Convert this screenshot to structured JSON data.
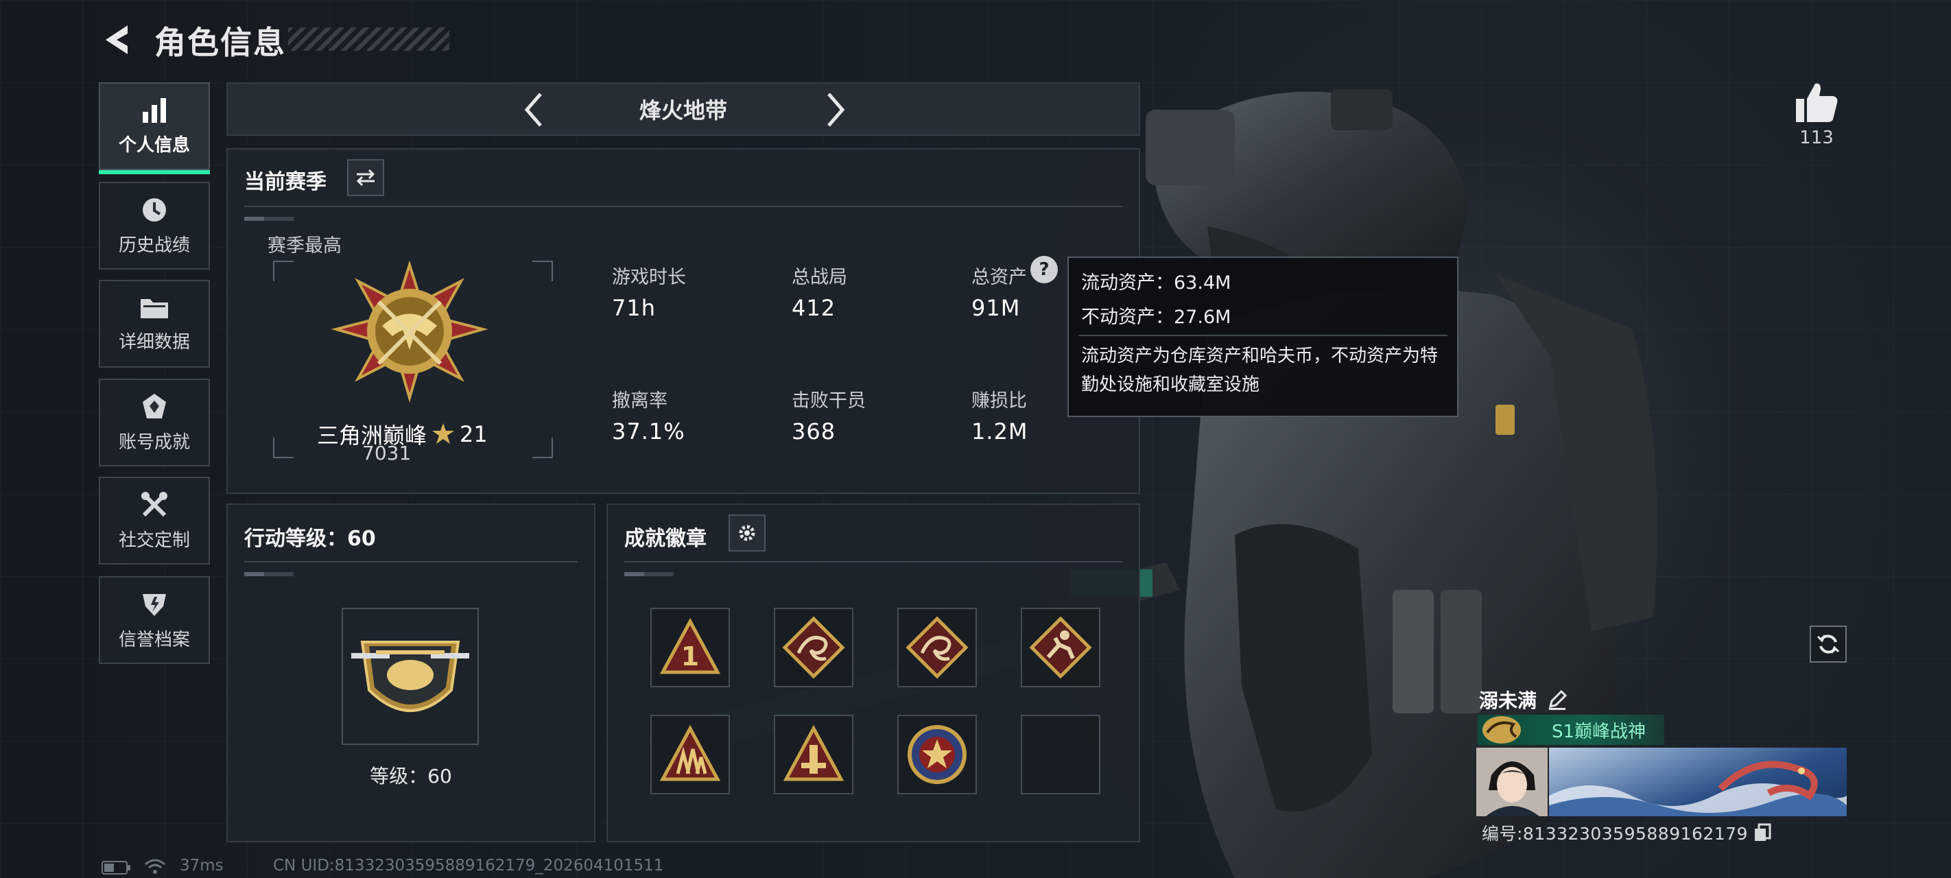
{
  "header": {
    "title": "角色信息"
  },
  "sidebar": {
    "items": [
      {
        "label": "个人信息",
        "active": true,
        "icon": "bar-chart-icon"
      },
      {
        "label": "历史战绩",
        "active": false,
        "icon": "clock-icon"
      },
      {
        "label": "详细数据",
        "active": false,
        "icon": "folder-icon"
      },
      {
        "label": "账号成就",
        "active": false,
        "icon": "achievement-icon"
      },
      {
        "label": "社交定制",
        "active": false,
        "icon": "tools-icon"
      },
      {
        "label": "信誉档案",
        "active": false,
        "icon": "shield-icon"
      }
    ]
  },
  "mode": {
    "name": "烽火地带"
  },
  "season": {
    "title": "当前赛季",
    "best_label": "赛季最高",
    "rank_name": "三角洲巅峰",
    "rank_stars": "21",
    "rank_score": "7031",
    "stats": [
      {
        "label": "游戏时长",
        "value": "71h"
      },
      {
        "label": "总战局",
        "value": "412"
      },
      {
        "label": "总资产",
        "value": "91M"
      },
      {
        "label": "撤离率",
        "value": "37.1%"
      },
      {
        "label": "击败干员",
        "value": "368"
      },
      {
        "label": "赚损比",
        "value": "1.2M"
      }
    ]
  },
  "tooltip": {
    "liquid": "流动资产：63.4M",
    "fixed": "不动资产：27.6M",
    "desc": "流动资产为仓库资产和哈夫币，不动资产为特勤处设施和收藏室设施"
  },
  "action_level": {
    "title": "行动等级：60",
    "level_text": "等级：60"
  },
  "achievements": {
    "title": "成就徽章",
    "badges": [
      "triangle-one-badge-icon",
      "dragon-badge-icon",
      "dragon-badge-icon",
      "runner-badge-icon",
      "squad-badge-icon",
      "tower-badge-icon",
      "star-roundel-badge-icon",
      "empty-slot"
    ]
  },
  "profile": {
    "likes": "113",
    "name": "溺未满",
    "title": "S1巅峰战神",
    "uid": "编号:8133230359588916217​9"
  },
  "status_bar": {
    "ping": "37ms",
    "uid": "CN UID:81332303595889162179_202604101511"
  },
  "colors": {
    "accent": "#2ee8a7",
    "panel": "#1e242b",
    "gold": "#c9a24a"
  }
}
